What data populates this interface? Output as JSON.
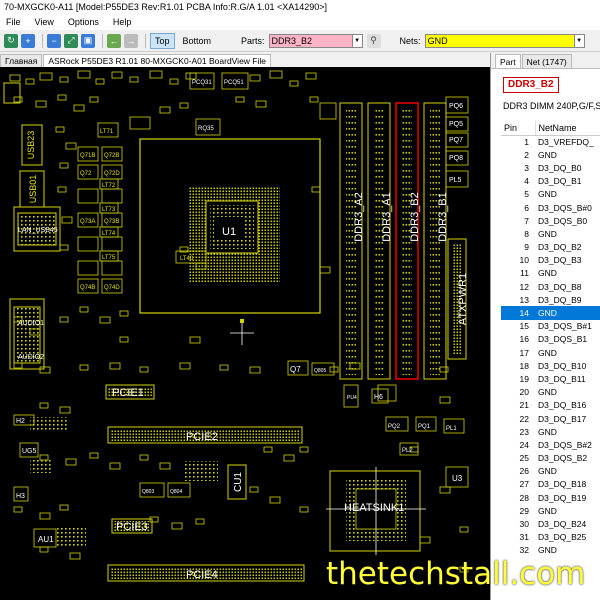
{
  "window": {
    "title": "70-MXGCK0-A11 [Model:P55DE3 Rev:R1.01 PCBA Info:R.G/A 1.01  <XA14290>]"
  },
  "menu": {
    "items": [
      "File",
      "View",
      "Options",
      "Help"
    ]
  },
  "toolbar": {
    "top_label": "Top",
    "bottom_label": "Bottom",
    "parts_label": "Parts:",
    "parts_value": "DDR3_B2",
    "nets_label": "Nets:",
    "nets_value": "GND"
  },
  "tabs": [
    "Главная",
    "ASRock P55DE3 R1.01 80-MXGCK0-A01 BoardView File"
  ],
  "board": {
    "labels": {
      "u1": "U1",
      "dimm_a2": "DDR3_A2",
      "dimm_a1": "DDR3_A1",
      "dimm_b2": "DDR3_B2",
      "dimm_b1": "DDR3_B1",
      "atxpwr": "ATXPWR1",
      "pcie1": "PCIE1",
      "pcie2": "PCIE2",
      "pcie3": "PCIE3",
      "pcie4": "PCIE4",
      "heatsink": "HEATSINK1",
      "cu1": "CU1",
      "au1": "AU1",
      "h2": "H2",
      "h3": "H3",
      "h6": "H6",
      "ug5": "UG5",
      "q7": "Q7",
      "u3": "U3",
      "pl5": "PL5",
      "pq6": "PQ6",
      "pq7": "PQ7",
      "pq8": "PQ8",
      "pq5": "PQ5",
      "usb23": "USB23",
      "usb01": "USB01",
      "lan": "LAN_USB45",
      "audio1": "AUDIO1",
      "audio2": "AUDIO2",
      "q71b": "Q71B",
      "q72b": "Q72B",
      "q72": "Q72",
      "q72d": "Q72D",
      "q73a": "Q73A",
      "q73b": "Q73B",
      "q74b": "Q74B",
      "q74d": "Q74D",
      "lt71": "LT71",
      "lt72": "LT72",
      "lt73": "LT73",
      "lt74": "LT74",
      "lt75": "LT75",
      "lt40": "LT40",
      "pq2": "PQ2",
      "pq1": "PQ1",
      "pl1": "PL1",
      "pl2": "PL2",
      "pu4": "PU4",
      "q805": "Q805",
      "q803": "Q803",
      "q804": "Q804",
      "q806": "Q806",
      "pq25": "PQ25",
      "pq21": "PQ21",
      "rq35": "RQ35",
      "pcq31": "PCQ31",
      "pcq51": "PCQ51"
    }
  },
  "right_panel": {
    "tabs": [
      "Part",
      "Net (1747)"
    ],
    "part_name": "DDR3_B2",
    "part_desc": "DDR3 DIMM 240P,G/F,Si",
    "columns": [
      "Pin",
      "NetName"
    ],
    "rows": [
      {
        "pin": "1",
        "net": "D3_VREFDQ_"
      },
      {
        "pin": "2",
        "net": "GND"
      },
      {
        "pin": "3",
        "net": "D3_DQ_B0"
      },
      {
        "pin": "4",
        "net": "D3_DQ_B1"
      },
      {
        "pin": "5",
        "net": "GND"
      },
      {
        "pin": "6",
        "net": "D3_DQS_B#0"
      },
      {
        "pin": "7",
        "net": "D3_DQS_B0"
      },
      {
        "pin": "8",
        "net": "GND"
      },
      {
        "pin": "9",
        "net": "D3_DQ_B2"
      },
      {
        "pin": "10",
        "net": "D3_DQ_B3"
      },
      {
        "pin": "11",
        "net": "GND"
      },
      {
        "pin": "12",
        "net": "D3_DQ_B8"
      },
      {
        "pin": "13",
        "net": "D3_DQ_B9"
      },
      {
        "pin": "14",
        "net": "GND"
      },
      {
        "pin": "15",
        "net": "D3_DQS_B#1"
      },
      {
        "pin": "16",
        "net": "D3_DQS_B1"
      },
      {
        "pin": "17",
        "net": "GND"
      },
      {
        "pin": "18",
        "net": "D3_DQ_B10"
      },
      {
        "pin": "19",
        "net": "D3_DQ_B11"
      },
      {
        "pin": "20",
        "net": "GND"
      },
      {
        "pin": "21",
        "net": "D3_DQ_B16"
      },
      {
        "pin": "22",
        "net": "D3_DQ_B17"
      },
      {
        "pin": "23",
        "net": "GND"
      },
      {
        "pin": "24",
        "net": "D3_DQS_B#2"
      },
      {
        "pin": "25",
        "net": "D3_DQS_B2"
      },
      {
        "pin": "26",
        "net": "GND"
      },
      {
        "pin": "27",
        "net": "D3_DQ_B18"
      },
      {
        "pin": "28",
        "net": "D3_DQ_B19"
      },
      {
        "pin": "29",
        "net": "GND"
      },
      {
        "pin": "30",
        "net": "D3_DQ_B24"
      },
      {
        "pin": "31",
        "net": "D3_DQ_B25"
      },
      {
        "pin": "32",
        "net": "GND"
      }
    ],
    "selected_pin": "14"
  },
  "watermark": "thetechstall.com",
  "colors": {
    "board_bg": "#000000",
    "silkscreen": "#e6e600",
    "part_field": "#ffb3c6",
    "net_field": "#ffff00",
    "selection": "#0078d7",
    "highlight": "#ff0000"
  }
}
